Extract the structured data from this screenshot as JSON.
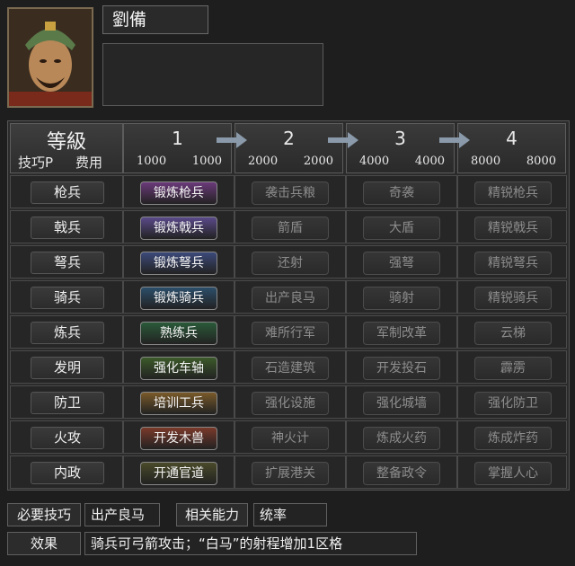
{
  "character": {
    "name": "劉備"
  },
  "table": {
    "header": {
      "title": "等級",
      "skill_p": "技巧P",
      "cost": "费用"
    },
    "levels": [
      {
        "level": "1",
        "skill_p": "1000",
        "cost": "1000"
      },
      {
        "level": "2",
        "skill_p": "2000",
        "cost": "2000"
      },
      {
        "level": "3",
        "skill_p": "4000",
        "cost": "4000"
      },
      {
        "level": "4",
        "skill_p": "8000",
        "cost": "8000"
      }
    ],
    "rows": [
      {
        "category": "枪兵",
        "skills": [
          "锻炼枪兵",
          "袭击兵粮",
          "奇袭",
          "精锐枪兵"
        ]
      },
      {
        "category": "戟兵",
        "skills": [
          "锻炼戟兵",
          "箭盾",
          "大盾",
          "精锐戟兵"
        ]
      },
      {
        "category": "弩兵",
        "skills": [
          "锻炼弩兵",
          "还射",
          "强弩",
          "精锐弩兵"
        ]
      },
      {
        "category": "骑兵",
        "skills": [
          "锻炼骑兵",
          "出产良马",
          "骑射",
          "精锐骑兵"
        ]
      },
      {
        "category": "炼兵",
        "skills": [
          "熟练兵",
          "难所行军",
          "军制改革",
          "云梯"
        ]
      },
      {
        "category": "发明",
        "skills": [
          "强化车轴",
          "石造建筑",
          "开发投石",
          "霹雳"
        ]
      },
      {
        "category": "防卫",
        "skills": [
          "培训工兵",
          "强化设施",
          "强化城墙",
          "强化防卫"
        ]
      },
      {
        "category": "火攻",
        "skills": [
          "开发木兽",
          "神火计",
          "炼成火药",
          "炼成炸药"
        ]
      },
      {
        "category": "内政",
        "skills": [
          "开通官道",
          "扩展港关",
          "整备政令",
          "掌握人心"
        ]
      }
    ],
    "active_colors": [
      "#6a3a7a",
      "#5a4a8a",
      "#3c4a7a",
      "#2c4e6a",
      "#2a5a3a",
      "#3c5a2a",
      "#7a5a2a",
      "#7a3a2a",
      "#4a4a2a"
    ]
  },
  "footer": {
    "required_label": "必要技巧",
    "required_value": "出产良马",
    "related_label": "相关能力",
    "related_value": "统率",
    "effect_label": "效果",
    "effect_value": "骑兵可弓箭攻击；“白马”的射程增加1区格"
  }
}
